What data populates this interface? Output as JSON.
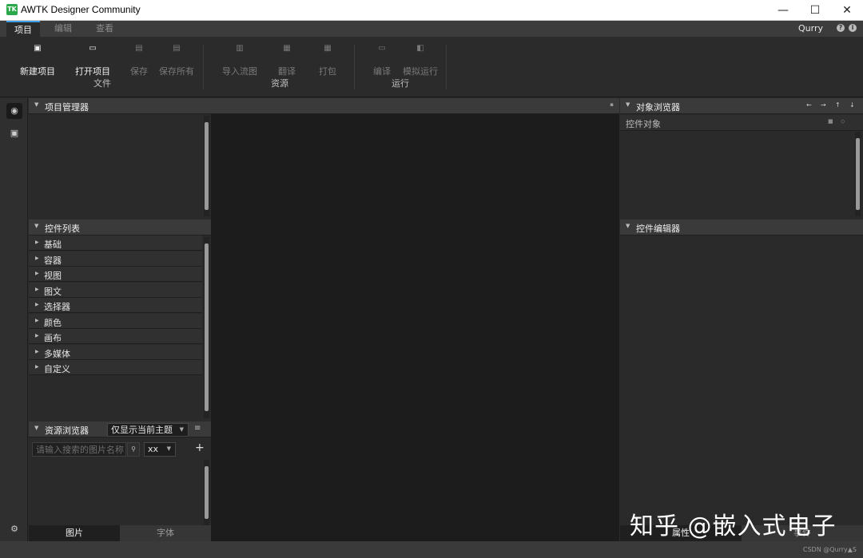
{
  "window": {
    "logo_text": "TK",
    "title": "AWTK Designer Community",
    "minimize": "—",
    "maximize": "☐",
    "close": "✕"
  },
  "menu": {
    "tabs": [
      "项目",
      "编辑",
      "查看"
    ],
    "active_tab": "项目",
    "user": "Qurry",
    "help_icon": "?",
    "info_icon": "i"
  },
  "toolbar": {
    "groups": [
      {
        "label": "文件",
        "buttons": [
          {
            "label": "新建项目",
            "icon": "new-project-icon",
            "enabled": true
          },
          {
            "label": "打开项目",
            "icon": "open-folder-icon",
            "enabled": true
          },
          {
            "label": "保存",
            "icon": "save-icon",
            "enabled": false
          },
          {
            "label": "保存所有",
            "icon": "save-all-icon",
            "enabled": false
          }
        ]
      },
      {
        "label": "资源",
        "buttons": [
          {
            "label": "导入流图",
            "icon": "import-icon",
            "enabled": false
          },
          {
            "label": "翻译",
            "icon": "translate-icon",
            "enabled": false
          },
          {
            "label": "打包",
            "icon": "package-icon",
            "enabled": false
          }
        ]
      },
      {
        "label": "运行",
        "buttons": [
          {
            "label": "编译",
            "icon": "compile-icon",
            "enabled": false
          },
          {
            "label": "模拟运行",
            "icon": "simulate-icon",
            "enabled": false
          }
        ]
      }
    ]
  },
  "project_manager": {
    "title": "项目管理器"
  },
  "control_list": {
    "title": "控件列表",
    "items": [
      "基础",
      "容器",
      "视图",
      "图文",
      "选择器",
      "颜色",
      "画布",
      "多媒体",
      "自定义"
    ]
  },
  "resource_browser": {
    "title": "资源浏览器",
    "filter_value": "仅显示当前主题",
    "search_placeholder": "请输入搜索的图片名称",
    "size_value": "xx",
    "add_label": "+",
    "tabs": [
      "图片",
      "字体"
    ],
    "active_tab": "图片"
  },
  "object_browser": {
    "title": "对象浏览器",
    "root_label": "控件对象"
  },
  "control_editor": {
    "title": "控件编辑器",
    "tabs": [
      "属性",
      "事件"
    ],
    "active_tab": "属性"
  },
  "overlay": {
    "watermark": "知乎 @嵌入式电子",
    "source": "CSDN @Qurry",
    "source_tail": "S"
  },
  "colors": {
    "accent": "#3c9ee5",
    "logo": "#2aa84a",
    "canvas": "#1c1c1c"
  }
}
